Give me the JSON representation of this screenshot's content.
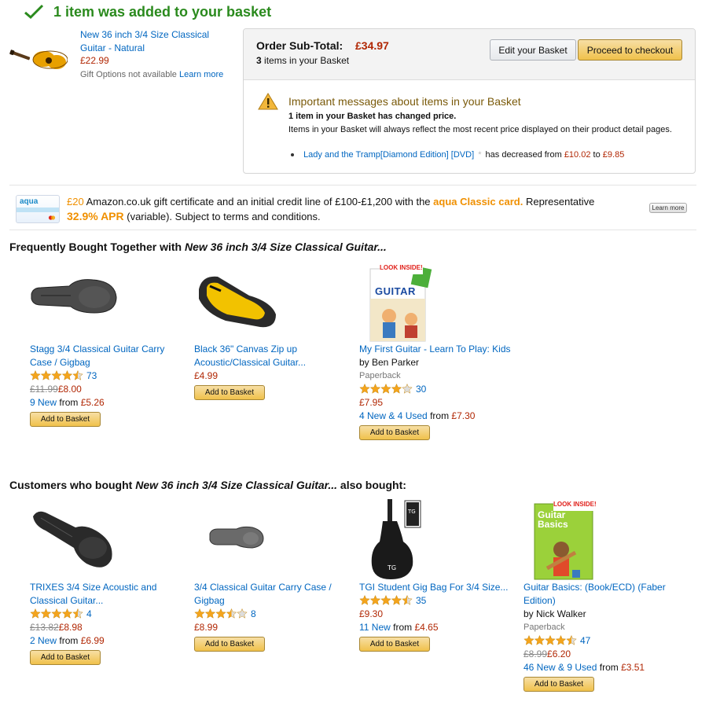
{
  "header": {
    "added_message": "1 item was added to your basket",
    "status_color": "#2a8a1d"
  },
  "added_item": {
    "title": "New 36 inch 3/4 Size Classical Guitar - Natural",
    "price": "£22.99",
    "gift_note": "Gift Options not available",
    "learn_more": "Learn more"
  },
  "order": {
    "subtotal_label": "Order Sub-Total:",
    "subtotal_value": "£34.97",
    "items_count_num": "3",
    "items_count_rest": "items in your Basket",
    "edit_button": "Edit your Basket",
    "checkout_button": "Proceed to checkout"
  },
  "messages": {
    "title": "Important messages about items in your Basket",
    "line1": "1 item in your Basket has changed price.",
    "line2": "Items in your Basket will always reflect the most recent price displayed on their product detail pages.",
    "bullet_link": "Lady and the Tramp[Diamond Edition] [DVD]",
    "bullet_text": "has decreased from",
    "old_price": "£10.02",
    "to": "to",
    "new_price": "£9.85"
  },
  "aqua": {
    "card_word": "aqua",
    "amount": "£20",
    "text1": "Amazon.co.uk gift certificate and an initial credit line of £100-£1,200 with the",
    "card_link": "aqua Classic card.",
    "text2": "Representative",
    "apr": "32.9% APR",
    "text3": "(variable). Subject to terms and conditions.",
    "learn_more": "Learn more"
  },
  "fbt": {
    "heading_prefix": "Frequently Bought Together with",
    "heading_title": "New 36 inch 3/4 Size Classical Guitar...",
    "products": [
      {
        "title": "Stagg 3/4 Classical Guitar Carry Case / Gigbag",
        "rating": 4.5,
        "reviews": "73",
        "old_price": "£11.99",
        "price": "£8.00",
        "offers": "9 New",
        "offers_from": "from",
        "offers_price": "£5.26",
        "button": "Add to Basket"
      },
      {
        "title": "Black 36\" Canvas Zip up Acoustic/Classical Guitar...",
        "price": "£4.99",
        "button": "Add to Basket"
      },
      {
        "title": "My First Guitar - Learn To Play: Kids",
        "author": "by Ben Parker",
        "format": "Paperback",
        "rating": 4,
        "reviews": "30",
        "price": "£7.95",
        "offers": "4 New & 4 Used",
        "offers_from": "from",
        "offers_price": "£7.30",
        "button": "Add to Basket",
        "badge": "LOOK INSIDE!",
        "book_title": "GUITAR"
      }
    ]
  },
  "also_bought": {
    "heading_prefix": "Customers who bought",
    "heading_title": "New 36 inch 3/4 Size Classical Guitar...",
    "heading_suffix": "also bought:",
    "products": [
      {
        "title": "TRIXES 3/4 Size Acoustic and Classical Guitar...",
        "rating": 4.5,
        "reviews": "4",
        "old_price": "£13.82",
        "price": "£8.98",
        "offers": "2 New",
        "offers_from": "from",
        "offers_price": "£6.99",
        "button": "Add to Basket"
      },
      {
        "title": "3/4 Classical Guitar Carry Case / Gigbag",
        "rating": 3.5,
        "reviews": "8",
        "price": "£8.99",
        "button": "Add to Basket"
      },
      {
        "title": "TGI Student Gig Bag For 3/4 Size...",
        "rating": 4.5,
        "reviews": "35",
        "price": "£9.30",
        "offers": "11 New",
        "offers_from": "from",
        "offers_price": "£4.65",
        "button": "Add to Basket"
      },
      {
        "title": "Guitar Basics: (Book/ECD) (Faber Edition)",
        "author": "by Nick Walker",
        "format": "Paperback",
        "rating": 4.5,
        "reviews": "47",
        "old_price": "£8.99",
        "price": "£6.20",
        "offers": "46 New & 9 Used",
        "offers_from": "from",
        "offers_price": "£3.51",
        "button": "Add to Basket",
        "badge": "LOOK INSIDE!",
        "book_title": "Guitar Basics"
      }
    ]
  },
  "colors": {
    "link": "#0066c0",
    "price": "#b12704",
    "star": "#f4a41c",
    "button_gold": "#f0c14b"
  }
}
